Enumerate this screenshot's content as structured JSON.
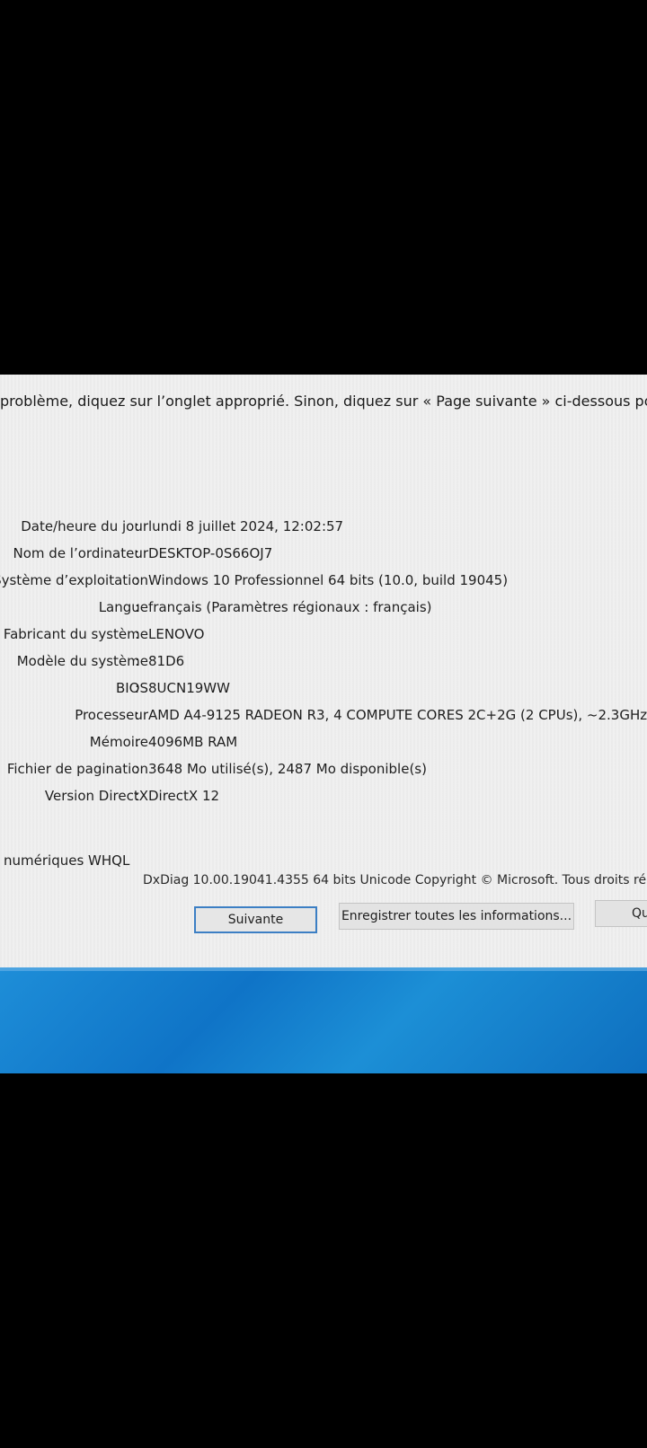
{
  "intro_text": "problème, diquez sur l’onglet approprié. Sinon, diquez sur « Page suivante » ci-dessous pour affic",
  "system_info": [
    {
      "label": "Date/heure du jour",
      "value": "lundi 8 juillet 2024, 12:02:57"
    },
    {
      "label": "Nom de l’ordinateur",
      "value": "DESKTOP-0S66OJ7"
    },
    {
      "label": "Système d’exploitation",
      "value": "Windows 10 Professionnel 64 bits (10.0, build 19045)"
    },
    {
      "label": "Langue",
      "value": "français (Paramètres régionaux : français)"
    },
    {
      "label": "Fabricant du système",
      "value": "LENOVO"
    },
    {
      "label": "Modèle du système",
      "value": "81D6"
    },
    {
      "label": "BIOS",
      "value": "8UCN19WW"
    },
    {
      "label": "Processeur",
      "value": "AMD A4-9125 RADEON R3, 4 COMPUTE CORES 2C+2G    (2 CPUs), ~2.3GHz"
    },
    {
      "label": "Mémoire",
      "value": "4096MB RAM"
    },
    {
      "label": "Fichier de pagination",
      "value": "3648 Mo utilisé(s), 2487 Mo disponible(s)"
    },
    {
      "label": "Version DirectX",
      "value": "DirectX 12"
    }
  ],
  "whql_text": "numériques WHQL",
  "copyright_text": "DxDiag 10.00.19041.4355 64 bits Unicode Copyright © Microsoft. Tous droits ré",
  "buttons": {
    "next": "Suivante",
    "save_all": "Enregistrer toutes les informations...",
    "quit": "Qu"
  },
  "colors": {
    "window_bg": "#f0f0f0",
    "primary_button_border": "#3c7fc4",
    "taskbar": "#1580cf"
  }
}
